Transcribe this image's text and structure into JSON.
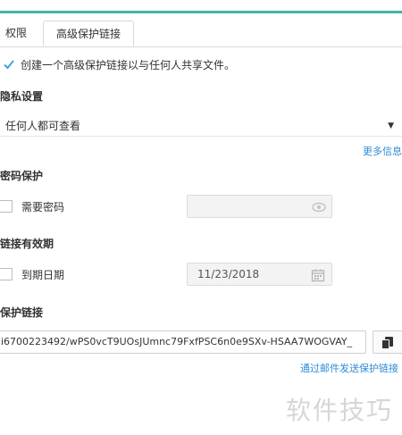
{
  "tabs": [
    {
      "label": "权限",
      "active": false
    },
    {
      "label": "高级保护链接",
      "active": true
    }
  ],
  "enable_protected_link": {
    "label": "创建一个高级保护链接以与任何人共享文件。",
    "checked": true
  },
  "privacy": {
    "title": "隐私设置",
    "selected": "任何人都可查看",
    "more_info": "更多信息"
  },
  "password": {
    "title": "密码保护",
    "checkbox_label": "需要密码",
    "checked": false,
    "value": ""
  },
  "expiry": {
    "title": "链接有效期",
    "checkbox_label": "到期日期",
    "checked": false,
    "date": "11/23/2018"
  },
  "protected_link": {
    "title": "保护链接",
    "url": "i6700223492/wPS0vcT9UOsJUmnc79FxfPSC6n0e9SXv-HSAA7WOGVAY_",
    "email_link": "通过邮件发送保护链接"
  },
  "watermark": "软件技巧",
  "colors": {
    "accent": "#3fb6a8",
    "link": "#2e8bd6"
  }
}
